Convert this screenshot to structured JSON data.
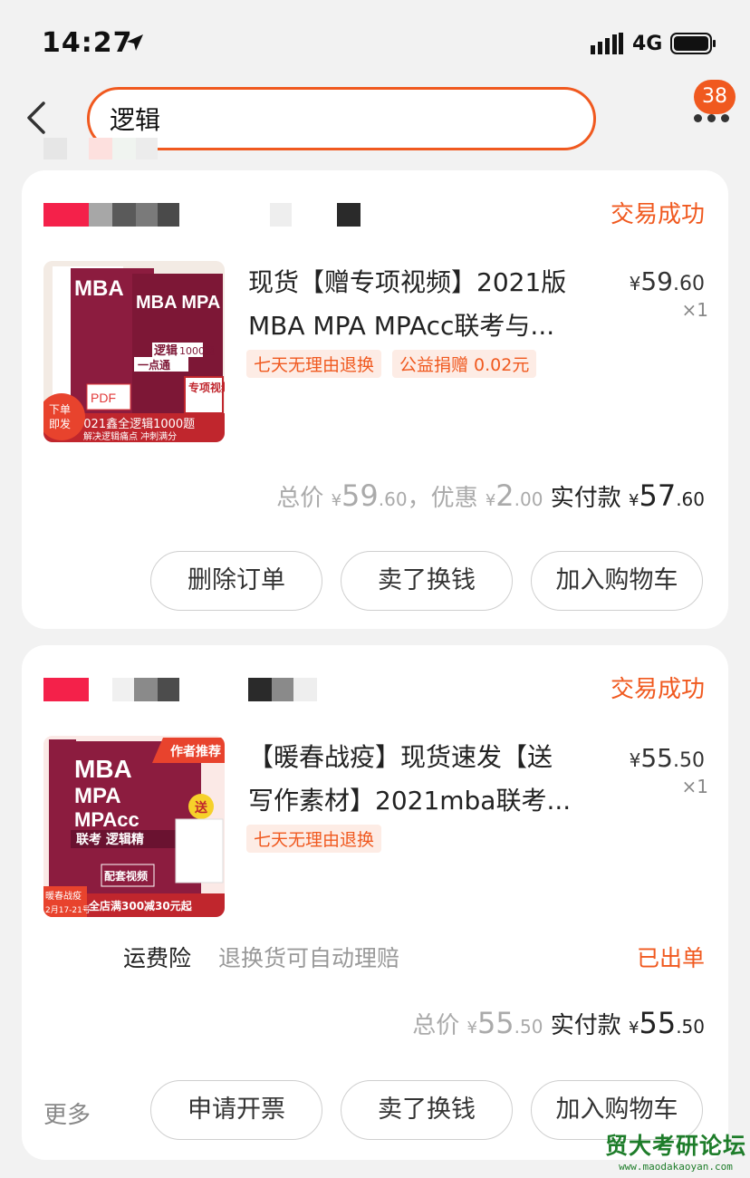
{
  "status_bar": {
    "time": "14:27",
    "network": "4G"
  },
  "search": {
    "query": "逻辑"
  },
  "header": {
    "badge": "38"
  },
  "orders": [
    {
      "status": "交易成功",
      "title_line1": "现货【赠专项视频】2021版",
      "title_line2": "MBA MPA MPAcc联考与...",
      "price_currency": "¥",
      "price_int": "59",
      "price_dec": ".60",
      "qty": "×1",
      "tags": [
        "七天无理由退换",
        "公益捐赠 0.02元"
      ],
      "total_label": "总价",
      "total_int": "59",
      "total_dec": ".60",
      "discount_label": "，优惠",
      "discount_int": "2",
      "discount_dec": ".00",
      "paid_label": "实付款",
      "paid_int": "57",
      "paid_dec": ".60",
      "buttons": [
        "删除订单",
        "卖了换钱",
        "加入购物车"
      ],
      "thumb": {
        "badge": "下单\n即发",
        "cover_title": "MBA MPA MEM MPAcc",
        "subject": "逻辑",
        "banner": "2021鑫全逻辑1000题",
        "banner_sub": "解决逻辑痛点 冲刺满分",
        "pdf": "PDF",
        "sticker": "专项视频",
        "volume": "1000题",
        "point": "一点通"
      }
    },
    {
      "status": "交易成功",
      "title_line1": "【暖春战疫】现货速发【送",
      "title_line2": "写作素材】2021mba联考...",
      "price_currency": "¥",
      "price_int": "55",
      "price_dec": ".50",
      "qty": "×1",
      "tags": [
        "七天无理由退换"
      ],
      "insurance_label": "运费险",
      "insurance_desc": "退换货可自动理赔",
      "insurance_status": "已出单",
      "total_label": "总价",
      "total_int": "55",
      "total_dec": ".50",
      "paid_label": "实付款",
      "paid_int": "55",
      "paid_dec": ".50",
      "more_label": "更多",
      "buttons": [
        "申请开票",
        "卖了换钱",
        "加入购物车"
      ],
      "thumb": {
        "ribbon": "作者推荐",
        "cover_title": "MBA MPA MPAcc",
        "subject": "联考 逻辑精",
        "send": "送",
        "video": "配套视频",
        "banner": "全店满300减30元起",
        "banner_left": "暖春战疫",
        "date": "2月17-21号"
      }
    }
  ],
  "watermark": {
    "main": "贸大考研论坛",
    "sub": "www.maodakaoyan.com"
  },
  "colors": {
    "accent": "#f0591f",
    "tag_bg": "#fdece5"
  }
}
